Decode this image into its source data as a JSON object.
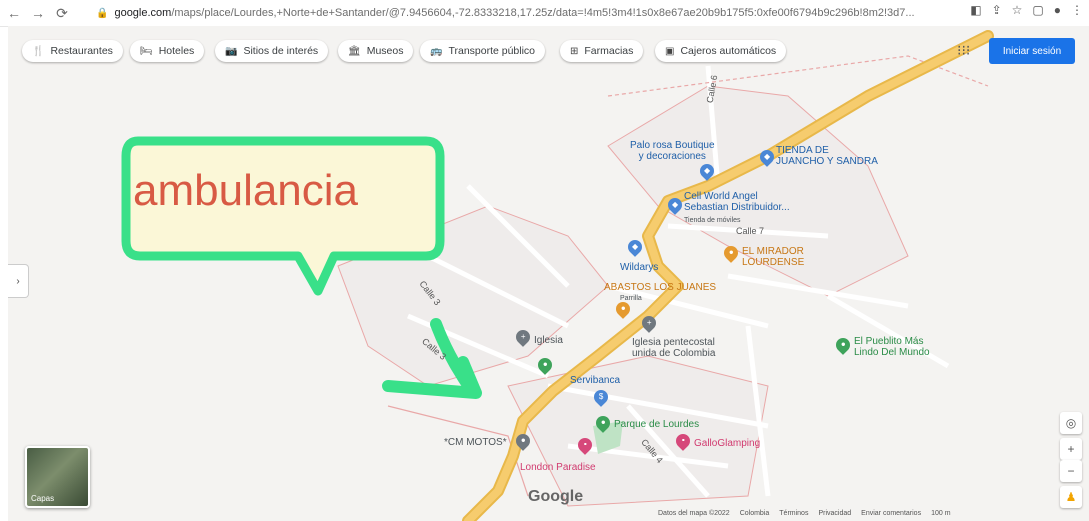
{
  "browser": {
    "url_host": "google.com",
    "url_path": "/maps/place/Lourdes,+Norte+de+Santander/@7.9456604,-72.8333218,17.25z/data=!4m5!3m4!1s0x8e67ae20b9b175f5:0xfe00f6794b9c296b!8m2!3d7...",
    "icons": [
      "back-icon",
      "forward-icon",
      "reload-icon",
      "lock-icon",
      "extension-icon",
      "share-icon",
      "star-icon",
      "sidebar-icon",
      "profile-icon"
    ]
  },
  "chips": [
    {
      "label": "Restaurantes",
      "icon": "fork-knife-icon"
    },
    {
      "label": "Hoteles",
      "icon": "bed-icon"
    },
    {
      "label": "Sitios de interés",
      "icon": "camera-icon"
    },
    {
      "label": "Museos",
      "icon": "museum-icon"
    },
    {
      "label": "Transporte público",
      "icon": "bus-icon"
    },
    {
      "label": "Farmacias",
      "icon": "pharmacy-icon"
    },
    {
      "label": "Cajeros automáticos",
      "icon": "atm-icon"
    }
  ],
  "header": {
    "signin_label": "Iniciar sesión"
  },
  "annotation": {
    "text": "ambulancia",
    "color": "#d85a44",
    "border_color": "#39e089"
  },
  "places": [
    {
      "label": "Palo rosa Boutique\ny decoraciones",
      "type": "blue"
    },
    {
      "label": "TIENDA DE\nJUANCHO Y SANDRA",
      "type": "blue"
    },
    {
      "label": "Cell World Angel\nSebastian Distribuidor...",
      "type": "blue"
    },
    {
      "label": "Tienda de móviles",
      "type": "gray"
    },
    {
      "label": "EL MIRADOR\nLOURDENSE",
      "type": "orange"
    },
    {
      "label": "Wildarys",
      "type": "blue"
    },
    {
      "label": "ABASTOS LOS JUANES",
      "type": "orange"
    },
    {
      "label": "Parrilla",
      "type": "gray"
    },
    {
      "label": "Iglesia",
      "type": "gray"
    },
    {
      "label": "Iglesia pentecostal\nunida de Colombia",
      "type": "gray"
    },
    {
      "label": "El Pueblito Más\nLindo Del Mundo",
      "type": "green"
    },
    {
      "label": "Servibanca",
      "type": "blue"
    },
    {
      "label": "Parque de Lourdes",
      "type": "green"
    },
    {
      "label": "GalloGlamping",
      "type": "pink"
    },
    {
      "label": "*CM MOTOS*",
      "type": "gray"
    },
    {
      "label": "London Paradise",
      "type": "pink"
    }
  ],
  "streets": [
    "Calle 3",
    "Calle 7",
    "Calle 3",
    "Calle 4",
    "Calle 6"
  ],
  "controls": {
    "layers_label": "Capas",
    "zoom_in": "+",
    "zoom_out": "−"
  },
  "footer": [
    "Datos del mapa ©2022",
    "Colombia",
    "Términos",
    "Privacidad",
    "Enviar comentarios",
    "100 m"
  ],
  "logo": "Google",
  "colors": {
    "road": "#f6cc6e",
    "road_outline": "#e8b84a",
    "boundary": "#e9a8a8",
    "signin": "#1a73e8"
  }
}
